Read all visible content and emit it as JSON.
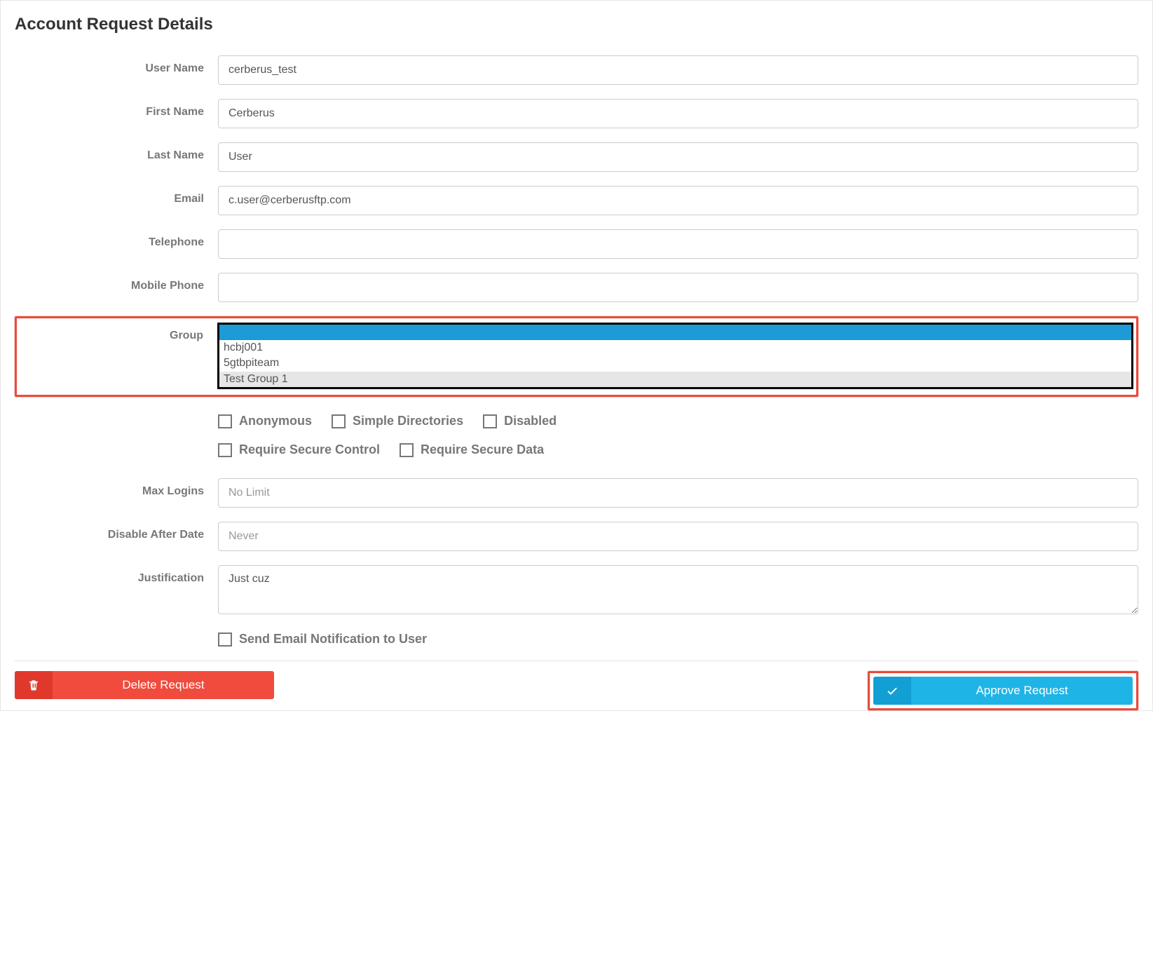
{
  "title": "Account Request Details",
  "labels": {
    "user_name": "User Name",
    "first_name": "First Name",
    "last_name": "Last Name",
    "email": "Email",
    "telephone": "Telephone",
    "mobile_phone": "Mobile Phone",
    "group": "Group",
    "max_logins": "Max Logins",
    "disable_after": "Disable After Date",
    "justification": "Justification"
  },
  "values": {
    "user_name": "cerberus_test",
    "first_name": "Cerberus",
    "last_name": "User",
    "email": "c.user@cerberusftp.com",
    "telephone": "",
    "mobile_phone": "",
    "max_logins": "",
    "disable_after": "",
    "justification": "Just cuz"
  },
  "placeholders": {
    "max_logins": "No Limit",
    "disable_after": "Never"
  },
  "group_options": {
    "selected_blank": "",
    "opt1": "hcbj001",
    "opt2": "5gtbpiteam",
    "opt3": "Test Group 1"
  },
  "checkboxes": {
    "anonymous": "Anonymous",
    "simple_directories": "Simple Directories",
    "disabled": "Disabled",
    "require_secure_control": "Require Secure Control",
    "require_secure_data": "Require Secure Data",
    "send_email_notification": "Send Email Notification to User"
  },
  "buttons": {
    "delete": "Delete Request",
    "approve": "Approve Request"
  },
  "colors": {
    "highlight_border": "#e74c3c",
    "delete_btn": "#f14b3d",
    "delete_btn_icon": "#e0392c",
    "approve_btn": "#1fb4e6",
    "approve_btn_icon": "#129fd4"
  }
}
